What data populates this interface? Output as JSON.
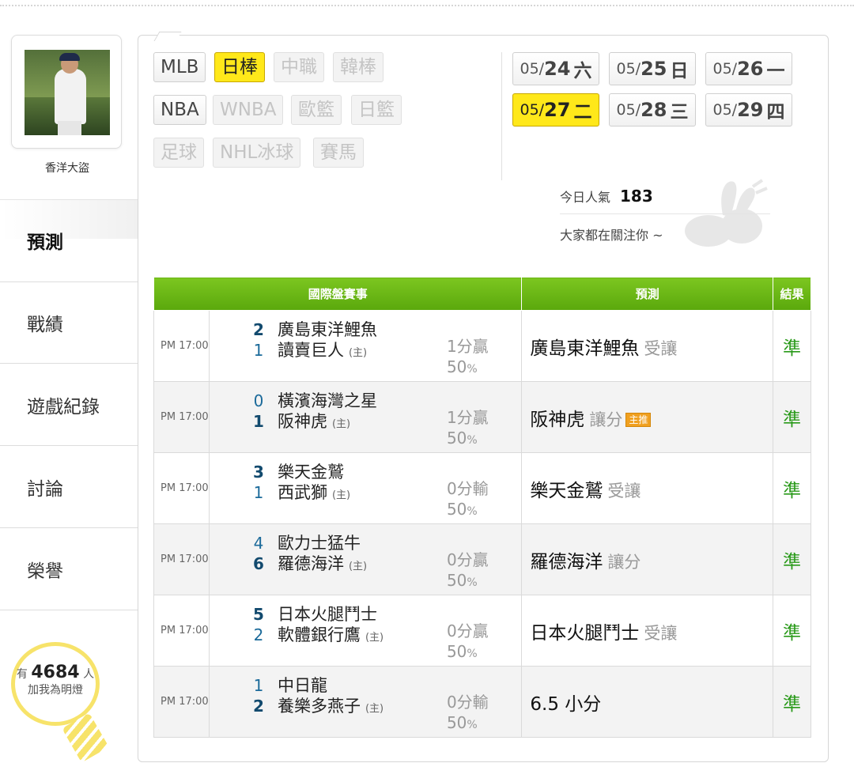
{
  "user": {
    "name": "香洋大盜"
  },
  "menu": [
    {
      "label": "預測",
      "active": true
    },
    {
      "label": "戰績"
    },
    {
      "label": "遊戲紀錄"
    },
    {
      "label": "討論"
    },
    {
      "label": "榮譽"
    }
  ],
  "lamp": {
    "prefix": "有",
    "count": "4684",
    "suffix": "人",
    "sub": "加我為明燈"
  },
  "sports": [
    {
      "label": "MLB",
      "state": "normal"
    },
    {
      "label": "日棒",
      "state": "selected"
    },
    {
      "label": "中職",
      "state": "disabled"
    },
    {
      "label": "韓棒",
      "state": "disabled"
    },
    {
      "label": "NBA",
      "state": "normal"
    },
    {
      "label": "WNBA",
      "state": "disabled"
    },
    {
      "label": "歐籃",
      "state": "disabled"
    },
    {
      "label": "日籃",
      "state": "disabled"
    },
    {
      "label": "足球",
      "state": "disabled"
    },
    {
      "label": "NHL冰球",
      "state": "disabled"
    },
    {
      "label": "賽馬",
      "state": "disabled"
    }
  ],
  "dates": [
    {
      "md": "05/",
      "d": "24",
      "w": "六"
    },
    {
      "md": "05/",
      "d": "25",
      "w": "日"
    },
    {
      "md": "05/",
      "d": "26",
      "w": "一"
    },
    {
      "md": "05/",
      "d": "27",
      "w": "二",
      "selected": true
    },
    {
      "md": "05/",
      "d": "28",
      "w": "三"
    },
    {
      "md": "05/",
      "d": "29",
      "w": "四"
    }
  ],
  "popularity": {
    "label": "今日人氣",
    "value": "183",
    "sub": "大家都在關注你 ~"
  },
  "table": {
    "headers": {
      "match": "國際盤賽事",
      "prediction": "預測",
      "result": "結果"
    },
    "host_mark": "(主)",
    "badge": "主推",
    "rows": [
      {
        "time": "PM 17:00",
        "away_score": "2",
        "away": "廣島東洋鯉魚",
        "home_score": "1",
        "home": "讀賣巨人",
        "spread": "1分贏",
        "pct": "50",
        "pred": "廣島東洋鯉魚",
        "note": "受讓",
        "badge": false,
        "result": "準",
        "winner": "away"
      },
      {
        "time": "PM 17:00",
        "away_score": "0",
        "away": "橫濱海灣之星",
        "home_score": "1",
        "home": "阪神虎",
        "spread": "1分贏",
        "pct": "50",
        "pred": "阪神虎",
        "note": "讓分",
        "badge": true,
        "result": "準",
        "winner": "home"
      },
      {
        "time": "PM 17:00",
        "away_score": "3",
        "away": "樂天金鷲",
        "home_score": "1",
        "home": "西武獅",
        "spread": "0分輸",
        "pct": "50",
        "pred": "樂天金鷲",
        "note": "受讓",
        "badge": false,
        "result": "準",
        "winner": "away"
      },
      {
        "time": "PM 17:00",
        "away_score": "4",
        "away": "歐力士猛牛",
        "home_score": "6",
        "home": "羅德海洋",
        "spread": "0分贏",
        "pct": "50",
        "pred": "羅德海洋",
        "note": "讓分",
        "badge": false,
        "result": "準",
        "winner": "home"
      },
      {
        "time": "PM 17:00",
        "away_score": "5",
        "away": "日本火腿鬥士",
        "home_score": "2",
        "home": "軟體銀行鷹",
        "spread": "0分贏",
        "pct": "50",
        "pred": "日本火腿鬥士",
        "note": "受讓",
        "badge": false,
        "result": "準",
        "winner": "away"
      },
      {
        "time": "PM 17:00",
        "away_score": "1",
        "away": "中日龍",
        "home_score": "2",
        "home": "養樂多燕子",
        "spread": "0分輸",
        "pct": "50",
        "pred": "6.5 小分",
        "note": "",
        "badge": false,
        "result": "準",
        "winner": "home"
      }
    ]
  },
  "colors": {
    "accent_green": "#6cb818",
    "selected_yellow": "#ffe81a",
    "result_green": "#2a9a1a",
    "score_blue": "#1b6a9a"
  }
}
